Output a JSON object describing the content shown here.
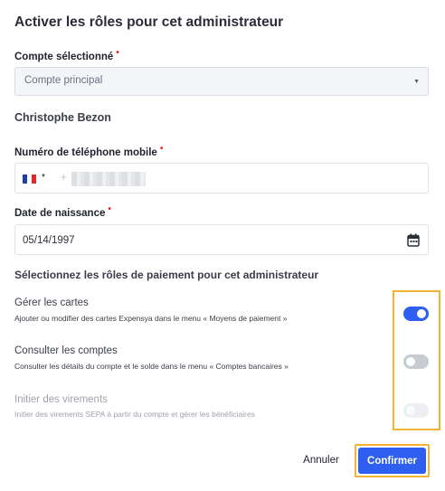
{
  "dialog": {
    "title": "Activer les rôles pour cet administrateur"
  },
  "account": {
    "label": "Compte sélectionné",
    "required_mark": "•",
    "selected_value": "Compte principal"
  },
  "person": {
    "name": "Christophe Bezon"
  },
  "phone": {
    "label": "Numéro de téléphone mobile",
    "required_mark": "•",
    "country_flag": "france-flag-icon",
    "value": "+"
  },
  "birthdate": {
    "label": "Date de naissance",
    "required_mark": "•",
    "value": "05/14/1997",
    "icon": "calendar-icon"
  },
  "roles": {
    "section_title": "Sélectionnez les rôles de paiement pour cet administrateur",
    "items": [
      {
        "title": "Gérer les cartes",
        "description": "Ajouter ou modifier des cartes Expensya dans le menu « Moyens de paiement »",
        "enabled": true,
        "disabled": false
      },
      {
        "title": "Consulter les comptes",
        "description": "Consulter les détails du compte et le solde dans le menu « Comptes bancaires »",
        "enabled": false,
        "disabled": false
      },
      {
        "title": "Initier des virements",
        "description": "Initier des virements SEPA à partir du compte et gérer les bénéficiaires",
        "enabled": false,
        "disabled": true
      }
    ]
  },
  "actions": {
    "cancel_label": "Annuler",
    "confirm_label": "Confirmer"
  },
  "colors": {
    "accent": "#2f5ff0",
    "highlight": "#f2b233",
    "required": "#e5262b"
  }
}
